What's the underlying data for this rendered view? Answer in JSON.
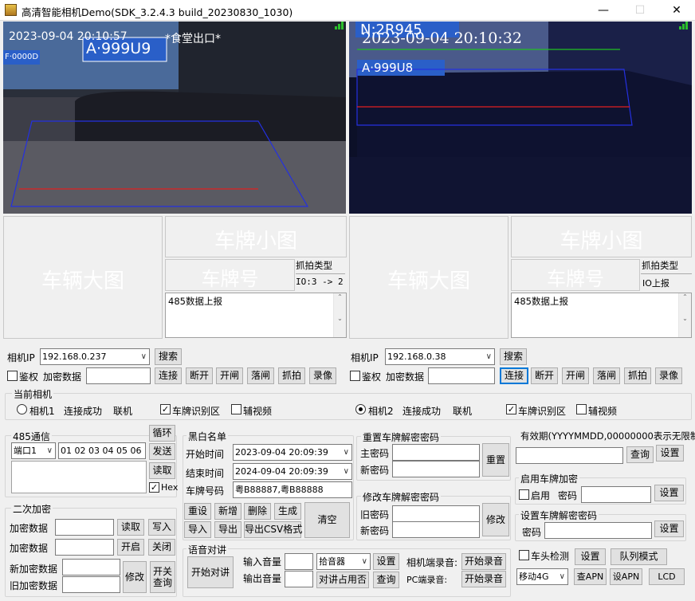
{
  "window": {
    "title": "高清智能相机Demo(SDK_3.2.4.3 build_20230830_1030)",
    "min": "—",
    "max": "☐",
    "close": "✕"
  },
  "left": {
    "overlay_time": "2023-09-04 20:10:57",
    "overlay_place": "*食堂出口*",
    "plate_text": "A·999U9",
    "plate_small": "F·0000D",
    "big_image": "车辆大图",
    "small_image": "车牌小图",
    "plate_no": "车牌号",
    "capture_type_label": "抓拍类型",
    "capture_type_value": "IO:3 -> 2",
    "rs485": "485数据上报",
    "ip_label": "相机IP",
    "ip": "192.168.0.237",
    "search": "搜索",
    "auth": "鉴权",
    "enc_label": "加密数据",
    "enc_value": "",
    "connect": "连接",
    "disconnect": "断开",
    "open": "开闸",
    "close": "落闸",
    "capture": "抓拍",
    "record": "录像"
  },
  "right": {
    "overlay_time": "2023-09-04 20:10:32",
    "plate_text": "A·999U8",
    "plate_top": "N:2R945",
    "big_image": "车辆大图",
    "small_image": "车牌小图",
    "plate_no": "车牌号",
    "capture_type_label": "抓拍类型",
    "capture_type_value": "IO上报",
    "rs485": "485数据上报",
    "ip_label": "相机IP",
    "ip": "192.168.0.38",
    "search": "搜索",
    "auth": "鉴权",
    "enc_label": "加密数据",
    "enc_value": "",
    "connect": "连接",
    "disconnect": "断开",
    "open": "开闸",
    "close": "落闸",
    "capture": "抓拍",
    "record": "录像"
  },
  "current": {
    "group": "当前相机",
    "cam1": "相机1",
    "cam1_status": "连接成功",
    "cam1_net": "联机",
    "plate_area": "车牌识别区",
    "aux_video": "辅视频",
    "cam2": "相机2",
    "cam2_status": "连接成功",
    "cam2_net": "联机",
    "plate_area2": "车牌识别区",
    "aux_video2": "辅视频"
  },
  "rs485": {
    "group": "485通信",
    "port": "端口1",
    "data": "01 02 03 04 05 06",
    "loop": "循环",
    "send": "发送",
    "read": "读取",
    "hex": "Hex"
  },
  "secondary": {
    "group": "二次加密",
    "enc_data": "加密数据",
    "read": "读取",
    "write": "写入",
    "enc_data2": "加密数据",
    "start": "开启",
    "close": "关闭",
    "new_enc": "新加密数据",
    "confirm_enc": "旧加密数据",
    "modify": "修改",
    "switch_query": "开关\n查询"
  },
  "blacklist": {
    "group": "黑白名单",
    "start_label": "开始时间",
    "start": "2023-09-04 20:09:39",
    "end_label": "结束时间",
    "end": "2024-09-04 20:09:39",
    "plate_label": "车牌号码",
    "plate": "粤B88887,粤B88888",
    "reset": "重设",
    "add": "新增",
    "delete": "删除",
    "generate": "生成",
    "clear": "清空",
    "import": "导入",
    "export": "导出",
    "export_csv": "导出CSV格式"
  },
  "reset_pwd": {
    "group": "重置车牌解密密码",
    "main": "主密码",
    "new": "新密码",
    "btn": "重置"
  },
  "modify_pwd": {
    "group": "修改车牌解密密码",
    "old": "旧密码",
    "new": "新密码",
    "btn": "修改"
  },
  "validity": {
    "group": "有效期(YYYYMMDD,00000000表示无限制)",
    "query": "查询",
    "set": "设置"
  },
  "enable": {
    "group": "启用车牌加密",
    "enable": "启用",
    "pwd": "密码",
    "set": "设置"
  },
  "setpwd": {
    "group": "设置车牌解密密码",
    "pwd": "密码",
    "set": "设置"
  },
  "voice": {
    "group": "语音对讲",
    "start": "开始对讲",
    "in_vol": "输入音量",
    "out_vol": "输出音量",
    "pickup": "拾音器",
    "set": "设置",
    "occupy": "对讲占用否",
    "query": "查询",
    "cam_rec": "相机端录音:",
    "pc_rec": "PC端录音:",
    "start_rec": "开始录音",
    "start_rec2": "开始录音"
  },
  "misc": {
    "head_detect": "车头检测",
    "set": "设置",
    "queue": "队列模式",
    "mobile": "移动4G",
    "query_apn": "查APN",
    "set_apn": "设APN",
    "lcd": "LCD"
  }
}
